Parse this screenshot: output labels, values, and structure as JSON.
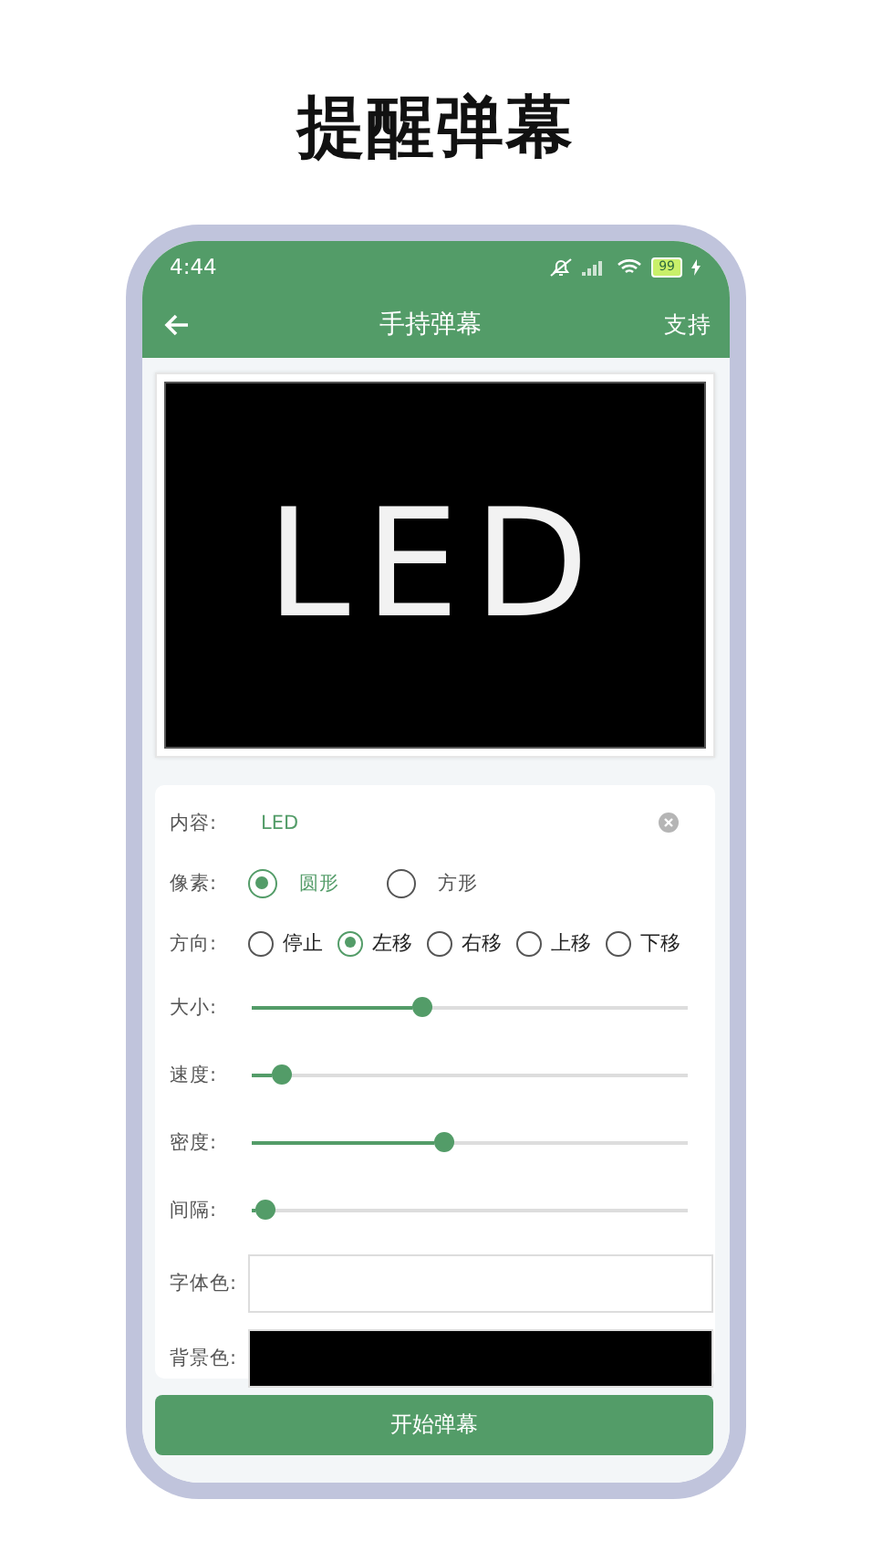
{
  "headline": "提醒弹幕",
  "status_bar": {
    "time": "4:44",
    "battery": "99"
  },
  "app_bar": {
    "title": "手持弹幕",
    "action": "支持"
  },
  "preview": {
    "text": "LED"
  },
  "form": {
    "content": {
      "label": "内容:",
      "value": "LED"
    },
    "options": [
      {
        "label": "像素:",
        "choices": [
          {
            "label": "圆形",
            "selected": true
          },
          {
            "label": "方形",
            "selected": false
          }
        ]
      },
      {
        "label": "方向:",
        "choices": [
          {
            "label": "停止",
            "selected": false
          },
          {
            "label": "左移",
            "selected": true
          },
          {
            "label": "右移",
            "selected": false
          },
          {
            "label": "上移",
            "selected": false
          },
          {
            "label": "下移",
            "selected": false
          }
        ]
      }
    ],
    "sliders": [
      {
        "label": "大小:",
        "level": 0.39
      },
      {
        "label": "速度:",
        "level": 0.07
      },
      {
        "label": "密度:",
        "level": 0.44
      },
      {
        "label": "间隔:",
        "level": 0.03
      }
    ],
    "colors": [
      {
        "label": "字体色:",
        "color": "#ffffff"
      },
      {
        "label": "背景色:",
        "color": "#000000"
      }
    ]
  },
  "start_button": "开始弹幕"
}
